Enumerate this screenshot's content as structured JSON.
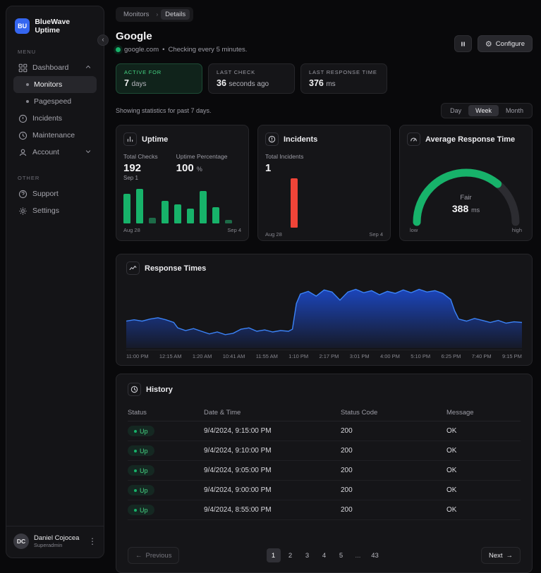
{
  "app": {
    "name": "BlueWave Uptime",
    "logo": "BU"
  },
  "sidebar": {
    "menu_label": "MENU",
    "other_label": "OTHER",
    "items": [
      {
        "label": "Dashboard"
      },
      {
        "label": "Monitors",
        "active": true
      },
      {
        "label": "Pagespeed"
      },
      {
        "label": "Incidents"
      },
      {
        "label": "Maintenance"
      },
      {
        "label": "Account"
      }
    ],
    "other_items": [
      {
        "label": "Support"
      },
      {
        "label": "Settings"
      }
    ],
    "user": {
      "initials": "DC",
      "name": "Daniel Cojocea",
      "role": "Superadmin"
    }
  },
  "breadcrumb": [
    "Monitors",
    "Details"
  ],
  "header": {
    "title": "Google",
    "url": "google.com",
    "separator": "•",
    "checking": "Checking every 5 minutes.",
    "configure_label": "Configure"
  },
  "stats": [
    {
      "label": "ACTIVE FOR",
      "value": "7",
      "suffix": "days"
    },
    {
      "label": "LAST CHECK",
      "value": "36",
      "suffix": "seconds ago"
    },
    {
      "label": "LAST RESPONSE TIME",
      "value": "376",
      "suffix": "ms"
    }
  ],
  "toolbar": {
    "caption": "Showing statistics for past 7 days.",
    "ranges": [
      "Day",
      "Week",
      "Month"
    ],
    "selected": "Week"
  },
  "cards": {
    "uptime": {
      "title": "Uptime",
      "metrics": [
        {
          "label": "Total Checks",
          "value": "192",
          "suffix": ""
        },
        {
          "label": "Uptime Percentage",
          "value": "100",
          "suffix": "%"
        }
      ],
      "hover_label": "Sep 1",
      "x_start": "Aug 28",
      "x_end": "Sep 4",
      "bars": [
        {
          "h": 72,
          "color": "#17b26a"
        },
        {
          "h": 84,
          "color": "#17b26a"
        },
        {
          "h": 14,
          "color": "#1d6b48"
        },
        {
          "h": 56,
          "color": "#17b26a"
        },
        {
          "h": 46,
          "color": "#17b26a"
        },
        {
          "h": 36,
          "color": "#17b26a"
        },
        {
          "h": 80,
          "color": "#17b26a"
        },
        {
          "h": 40,
          "color": "#17b26a"
        },
        {
          "h": 9,
          "color": "#1d6b48"
        }
      ]
    },
    "incidents": {
      "title": "Incidents",
      "metric_label": "Total Incidents",
      "metric_value": "1",
      "x_start": "Aug 28",
      "x_end": "Sep 4",
      "bars": [
        {
          "h": 0,
          "color": "#f04438"
        },
        {
          "h": 0,
          "color": "#f04438"
        },
        {
          "h": 92,
          "color": "#f04438"
        },
        {
          "h": 0,
          "color": "#f04438"
        },
        {
          "h": 0,
          "color": "#f04438"
        },
        {
          "h": 0,
          "color": "#f04438"
        },
        {
          "h": 0,
          "color": "#f04438"
        },
        {
          "h": 0,
          "color": "#f04438"
        },
        {
          "h": 0,
          "color": "#f04438"
        }
      ]
    },
    "gauge": {
      "title": "Average Response Time",
      "status": "Fair",
      "value": "388",
      "unit": "ms",
      "low": "low",
      "high": "high",
      "fraction": 0.72,
      "color": "#17b26a",
      "track_color": "#2c2c31"
    }
  },
  "response_times": {
    "title": "Response Times",
    "line_color": "#3b82f6",
    "fill_top": "rgba(29,78,216,0.85)",
    "fill_bottom": "rgba(29,78,216,0.08)",
    "x_labels": [
      "11:00 PM",
      "12:15 AM",
      "1:20 AM",
      "10:41 AM",
      "11:55 AM",
      "1:10 PM",
      "2:17 PM",
      "3:01 PM",
      "4:00 PM",
      "5:10 PM",
      "6:25 PM",
      "7:40 PM",
      "9:15 PM"
    ],
    "points": [
      [
        0,
        40
      ],
      [
        2,
        42
      ],
      [
        4,
        40
      ],
      [
        6,
        43
      ],
      [
        8,
        45
      ],
      [
        10,
        42
      ],
      [
        12,
        38
      ],
      [
        13,
        30
      ],
      [
        15,
        26
      ],
      [
        17,
        29
      ],
      [
        19,
        25
      ],
      [
        21,
        21
      ],
      [
        23,
        24
      ],
      [
        25,
        20
      ],
      [
        27,
        22
      ],
      [
        29,
        28
      ],
      [
        31,
        30
      ],
      [
        33,
        25
      ],
      [
        35,
        27
      ],
      [
        37,
        24
      ],
      [
        39,
        26
      ],
      [
        41,
        25
      ],
      [
        42,
        28
      ],
      [
        43,
        66
      ],
      [
        44,
        80
      ],
      [
        46,
        84
      ],
      [
        48,
        77
      ],
      [
        50,
        86
      ],
      [
        52,
        83
      ],
      [
        54,
        71
      ],
      [
        56,
        83
      ],
      [
        58,
        87
      ],
      [
        60,
        82
      ],
      [
        62,
        85
      ],
      [
        64,
        79
      ],
      [
        66,
        84
      ],
      [
        68,
        81
      ],
      [
        70,
        86
      ],
      [
        72,
        82
      ],
      [
        74,
        87
      ],
      [
        76,
        83
      ],
      [
        78,
        85
      ],
      [
        80,
        81
      ],
      [
        82,
        72
      ],
      [
        83,
        55
      ],
      [
        84,
        43
      ],
      [
        86,
        40
      ],
      [
        88,
        44
      ],
      [
        90,
        41
      ],
      [
        92,
        38
      ],
      [
        94,
        41
      ],
      [
        96,
        37
      ],
      [
        98,
        39
      ],
      [
        100,
        38
      ]
    ]
  },
  "history": {
    "title": "History",
    "columns": [
      "Status",
      "Date & Time",
      "Status Code",
      "Message"
    ],
    "rows": [
      {
        "status": "Up",
        "datetime": "9/4/2024, 9:15:00 PM",
        "code": "200",
        "message": "OK"
      },
      {
        "status": "Up",
        "datetime": "9/4/2024, 9:10:00 PM",
        "code": "200",
        "message": "OK"
      },
      {
        "status": "Up",
        "datetime": "9/4/2024, 9:05:00 PM",
        "code": "200",
        "message": "OK"
      },
      {
        "status": "Up",
        "datetime": "9/4/2024, 9:00:00 PM",
        "code": "200",
        "message": "OK"
      },
      {
        "status": "Up",
        "datetime": "9/4/2024, 8:55:00 PM",
        "code": "200",
        "message": "OK"
      }
    ],
    "pagination": {
      "prev_label": "Previous",
      "next_label": "Next",
      "pages": [
        "1",
        "2",
        "3",
        "4",
        "5",
        "...",
        "43"
      ],
      "active": "1"
    }
  }
}
